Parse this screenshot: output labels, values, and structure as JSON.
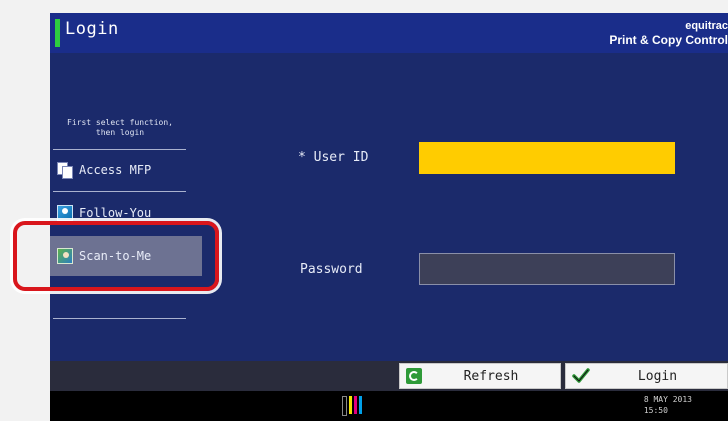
{
  "header": {
    "title": "Login",
    "brand_logo": "equitrac",
    "brand_subtitle": "Print & Copy Control"
  },
  "nav": {
    "hint": "First select function, then login",
    "items": [
      {
        "label": "Access MFP",
        "icon": "document-copy-icon",
        "selected": false
      },
      {
        "label": "Follow-You",
        "icon": "person-icon",
        "selected": false
      },
      {
        "label": "Scan-to-Me",
        "icon": "scan-person-icon",
        "selected": true
      }
    ]
  },
  "form": {
    "user_id_label": "* User ID",
    "user_id_value": "",
    "password_label": "Password",
    "password_value": ""
  },
  "bottom": {
    "refresh_label": "Refresh",
    "login_label": "Login"
  },
  "status": {
    "date": "8 MAY  2013",
    "time": "15:50"
  },
  "colors": {
    "background": "#1b2a6b",
    "header": "#1a2d8a",
    "accent": "#2ecc40",
    "user_id_field": "#ffcc00",
    "highlight": "#d9161c"
  }
}
